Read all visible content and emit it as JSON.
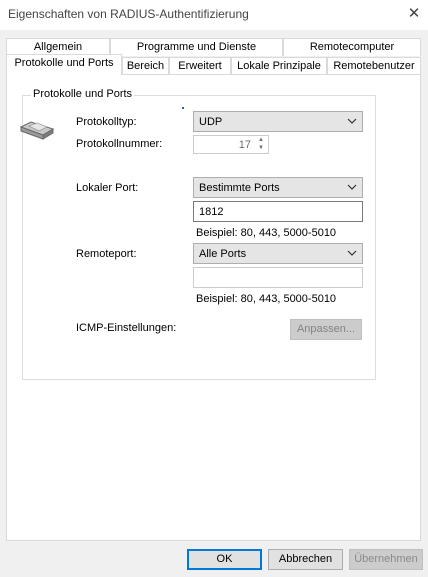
{
  "window": {
    "title": "Eigenschaften von RADIUS-Authentifizierung",
    "close_glyph": "✕"
  },
  "tabs": {
    "row1": [
      "Allgemein",
      "Programme und Dienste",
      "Remotecomputer"
    ],
    "row2": [
      "Protokolle und Ports",
      "Bereich",
      "Erweitert",
      "Lokale Prinzipale",
      "Remotebenutzer"
    ],
    "selected": "Protokolle und Ports"
  },
  "group": {
    "label": "Protokolle und Ports",
    "icon": "network-cable-icon"
  },
  "fields": {
    "protocol_type_label": "Protokolltyp:",
    "protocol_type_value": "UDP",
    "protocol_number_label": "Protokollnummer:",
    "protocol_number_value": "17",
    "local_port_label": "Lokaler Port:",
    "local_port_mode": "Bestimmte Ports",
    "local_port_value": "1812",
    "local_port_example": "Beispiel: 80, 443, 5000-5010",
    "remote_port_label": "Remoteport:",
    "remote_port_mode": "Alle Ports",
    "remote_port_value": "",
    "remote_port_example": "Beispiel: 80, 443, 5000-5010",
    "icmp_label": "ICMP-Einstellungen:",
    "icmp_button": "Anpassen..."
  },
  "footer": {
    "ok": "OK",
    "cancel": "Abbrechen",
    "apply": "Übernehmen"
  },
  "colors": {
    "accent": "#0078d7",
    "disabled_text": "#6d6d6d"
  }
}
